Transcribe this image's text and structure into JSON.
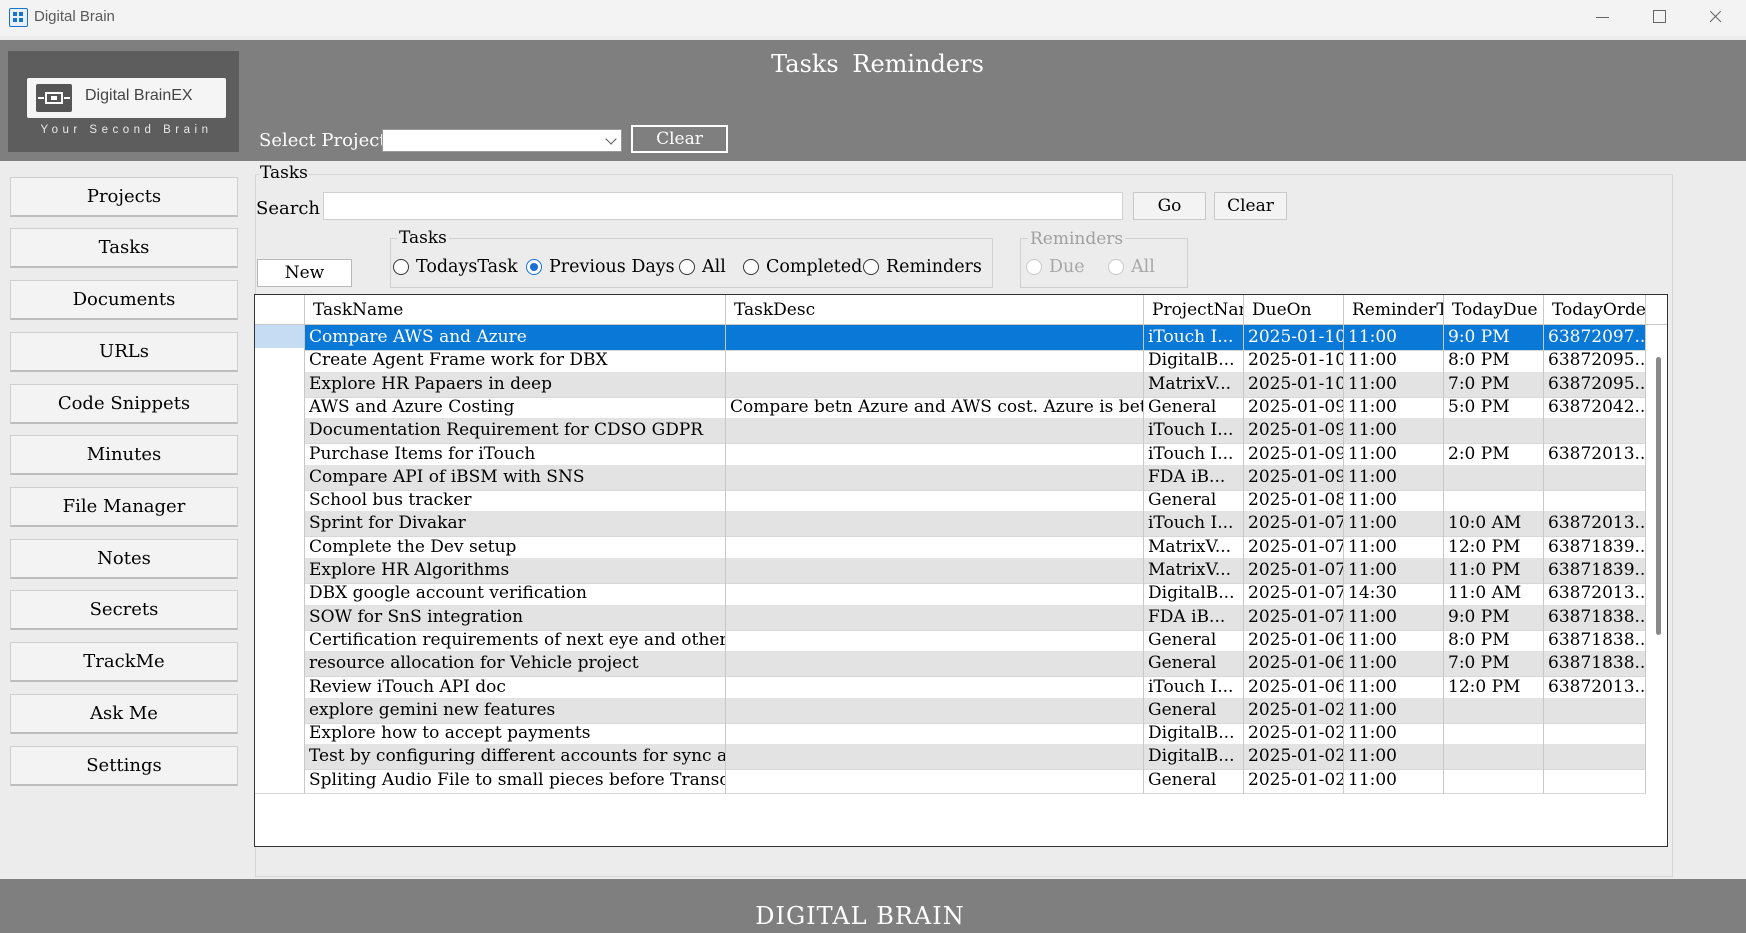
{
  "window": {
    "title": "Digital Brain"
  },
  "logo": {
    "name": "Digital BrainEX",
    "tagline": "Your Second Brain"
  },
  "header": {
    "title": "Tasks  Reminders",
    "select_project_label": "Select Project",
    "project_value": "",
    "clear_label": "Clear"
  },
  "sidebar": {
    "items": [
      {
        "label": "Projects"
      },
      {
        "label": "Tasks"
      },
      {
        "label": "Documents"
      },
      {
        "label": "URLs"
      },
      {
        "label": "Code Snippets"
      },
      {
        "label": "Minutes"
      },
      {
        "label": "File Manager"
      },
      {
        "label": "Notes"
      },
      {
        "label": "Secrets"
      },
      {
        "label": "TrackMe"
      },
      {
        "label": "Ask Me"
      },
      {
        "label": "Settings"
      }
    ]
  },
  "tasks_panel": {
    "group_label": "Tasks",
    "search_label": "Search",
    "search_value": "",
    "go_label": "Go",
    "clear_label": "Clear",
    "new_label": "New",
    "filter": {
      "label": "Tasks",
      "options": [
        {
          "label": "TodaysTask",
          "checked": false
        },
        {
          "label": "Previous Days",
          "checked": true
        },
        {
          "label": "All",
          "checked": false
        },
        {
          "label": "Completed",
          "checked": false
        },
        {
          "label": "Reminders",
          "checked": false
        }
      ]
    },
    "reminders": {
      "label": "Reminders",
      "options": [
        {
          "label": "Due",
          "checked": false
        },
        {
          "label": "All",
          "checked": false
        }
      ]
    }
  },
  "grid": {
    "columns": [
      "TaskName",
      "TaskDesc",
      "ProjectNam",
      "DueOn",
      "ReminderT",
      "TodayDue",
      "TodayOrde"
    ],
    "rows": [
      [
        "Compare AWS and Azure",
        "",
        "iTouch I...",
        "2025-01-10",
        "11:00",
        "9:0 PM",
        "63872097..."
      ],
      [
        "Create Agent Frame work for DBX",
        "",
        "DigitalB...",
        "2025-01-10",
        "11:00",
        "8:0 PM",
        "63872095..."
      ],
      [
        "Explore HR Papaers in deep",
        "",
        "MatrixV...",
        "2025-01-10",
        "11:00",
        "7:0 PM",
        "63872095..."
      ],
      [
        "AWS and Azure Costing",
        "Compare betn Azure and AWS cost. Azure is bett...",
        "General",
        "2025-01-09",
        "11:00",
        "5:0 PM",
        "63872042..."
      ],
      [
        "Documentation Requirement for CDSO GDPR",
        "",
        "iTouch I...",
        "2025-01-09",
        "11:00",
        "",
        ""
      ],
      [
        "Purchase Items for iTouch",
        "",
        "iTouch I...",
        "2025-01-09",
        "11:00",
        "2:0 PM",
        "63872013..."
      ],
      [
        "Compare API of iBSM with SNS",
        "",
        "FDA iB...",
        "2025-01-09",
        "11:00",
        "",
        ""
      ],
      [
        "School bus tracker",
        "",
        "General",
        "2025-01-08",
        "11:00",
        "",
        ""
      ],
      [
        "Sprint for Divakar",
        "",
        "iTouch I...",
        "2025-01-07",
        "11:00",
        "10:0 AM",
        "63872013..."
      ],
      [
        "Complete the Dev setup",
        "",
        "MatrixV...",
        "2025-01-07",
        "11:00",
        "12:0 PM",
        "63871839..."
      ],
      [
        "Explore HR Algorithms",
        "",
        "MatrixV...",
        "2025-01-07",
        "11:00",
        "11:0 PM",
        "63871839..."
      ],
      [
        "DBX google account verification",
        "",
        "DigitalB...",
        "2025-01-07",
        "14:30",
        "11:0 AM",
        "63872013..."
      ],
      [
        "SOW for SnS integration",
        "",
        "FDA iB...",
        "2025-01-07",
        "11:00",
        "9:0 PM",
        "63871838..."
      ],
      [
        "Certification requirements of next eye and other ...",
        "",
        "General",
        "2025-01-06",
        "11:00",
        "8:0 PM",
        "63871838..."
      ],
      [
        "resource allocation for Vehicle project",
        "",
        "General",
        "2025-01-06",
        "11:00",
        "7:0 PM",
        "63871838..."
      ],
      [
        "Review iTouch API doc",
        "",
        "iTouch I...",
        "2025-01-06",
        "11:00",
        "12:0 PM",
        "63872013..."
      ],
      [
        "explore gemini new features",
        "",
        "General",
        "2025-01-02",
        "11:00",
        "",
        ""
      ],
      [
        "Explore how to accept payments",
        "",
        "DigitalB...",
        "2025-01-02",
        "11:00",
        "",
        ""
      ],
      [
        "Test by configuring different accounts for sync a...",
        "",
        "DigitalB...",
        "2025-01-02",
        "11:00",
        "",
        ""
      ],
      [
        "Spliting Audio File to small pieces before Transc...",
        "",
        "General",
        "2025-01-02",
        "11:00",
        "",
        ""
      ]
    ]
  },
  "footer": {
    "text": "DIGITAL BRAIN"
  },
  "colors": {
    "header_bg": "#7f7f7f",
    "selected_row": "#0a78d7",
    "alt_row": "#e3e3e3"
  }
}
